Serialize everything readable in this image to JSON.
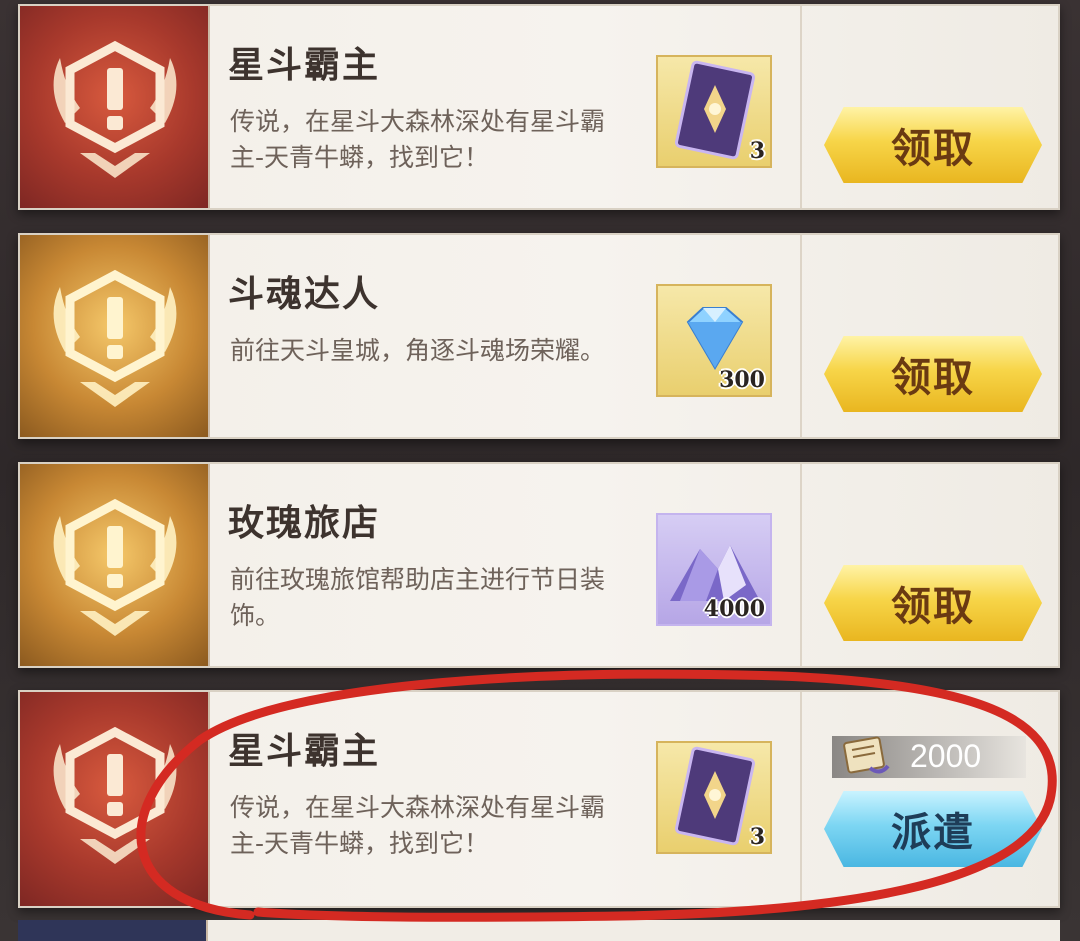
{
  "quests": [
    {
      "title": "星斗霸主",
      "description": "传说，在星斗大森林深处有星斗霸主-天青牛蟒，找到它！",
      "badge_color": "red",
      "reward": {
        "icon": "card-pack-icon",
        "quantity": "3"
      },
      "action": {
        "label": "领取",
        "style": "gold"
      }
    },
    {
      "title": "斗魂达人",
      "description": "前往天斗皇城，角逐斗魂场荣耀。",
      "badge_color": "gold",
      "reward": {
        "icon": "diamond-icon",
        "quantity": "300"
      },
      "action": {
        "label": "领取",
        "style": "gold"
      }
    },
    {
      "title": "玫瑰旅店",
      "description": "前往玫瑰旅馆帮助店主进行节日装饰。",
      "badge_color": "gold",
      "reward": {
        "icon": "crystal-pile-icon",
        "quantity": "4000"
      },
      "action": {
        "label": "领取",
        "style": "gold"
      }
    },
    {
      "title": "星斗霸主",
      "description": "传说，在星斗大森林深处有星斗霸主-天青牛蟒，找到它！",
      "badge_color": "red",
      "reward": {
        "icon": "card-pack-icon",
        "quantity": "3"
      },
      "cost": {
        "icon": "scroll-icon",
        "amount": "2000"
      },
      "action": {
        "label": "派遣",
        "style": "blue"
      }
    }
  ],
  "colors": {
    "badge_red": "#a8392c",
    "badge_gold": "#c88834",
    "button_gold": "#f7d548",
    "button_blue": "#7dd6f3",
    "annotation_red": "#d42a22"
  }
}
